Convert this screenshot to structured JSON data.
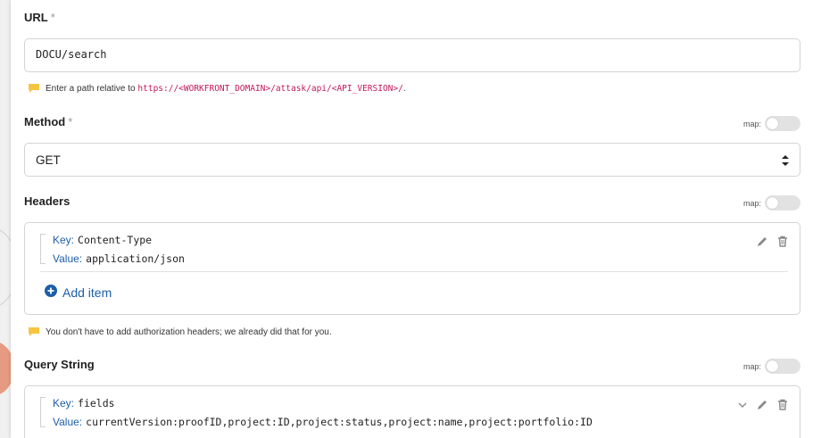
{
  "url_field": {
    "label": "URL",
    "required_mark": "*",
    "value": "DOCU/search",
    "hint_prefix": "Enter a path relative to",
    "hint_code": "https://<WORKFRONT_DOMAIN>/attask/api/<API_VERSION>/",
    "hint_suffix": "."
  },
  "method_field": {
    "label": "Method",
    "required_mark": "*",
    "map_label": "map:",
    "value": "GET"
  },
  "headers_field": {
    "label": "Headers",
    "map_label": "map:",
    "items": [
      {
        "key_label": "Key:",
        "key": "Content-Type",
        "value_label": "Value:",
        "value": "application/json"
      }
    ],
    "add_item_label": "Add item",
    "hint": "You don't have to add authorization headers; we already did that for you."
  },
  "query_field": {
    "label": "Query String",
    "map_label": "map:",
    "items": [
      {
        "key_label": "Key:",
        "key": "fields",
        "value_label": "Value:",
        "value": "currentVersion:proofID,project:ID,project:status,project:name,project:portfolio:ID"
      }
    ]
  },
  "colors": {
    "accent": "#1d5ea8",
    "hint_icon": "#f5c542",
    "code": "#c2185b"
  },
  "icons": {
    "hint": "comment-icon",
    "edit": "pencil-icon",
    "delete": "trash-icon",
    "add": "plus-circle-icon",
    "expand": "chevron-down-icon",
    "select": "select-arrows-icon"
  }
}
